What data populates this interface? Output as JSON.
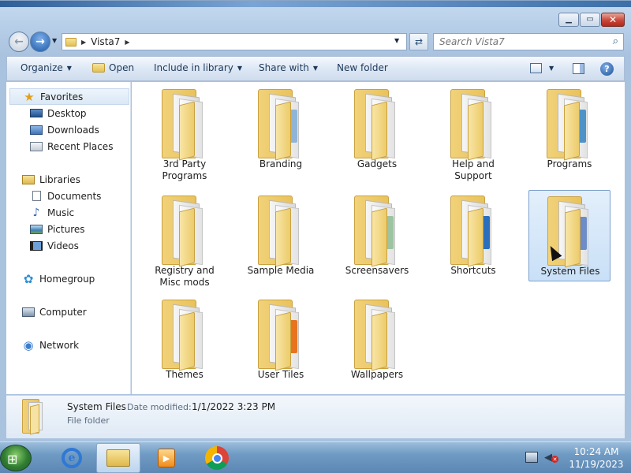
{
  "window": {
    "caption_buttons": {
      "minimize_icon": "minimize-icon",
      "maximize_icon": "maximize-icon",
      "close_icon": "close-icon"
    }
  },
  "address_bar": {
    "breadcrumbs": [
      "Vista7"
    ],
    "search_placeholder": "Search Vista7"
  },
  "command_bar": {
    "organize": "Organize",
    "open": "Open",
    "include_in_library": "Include in library",
    "share_with": "Share with",
    "new_folder": "New folder"
  },
  "navigation": {
    "favorites": {
      "label": "Favorites",
      "items": [
        "Desktop",
        "Downloads",
        "Recent Places"
      ]
    },
    "libraries": {
      "label": "Libraries",
      "items": [
        "Documents",
        "Music",
        "Pictures",
        "Videos"
      ]
    },
    "homegroup": "Homegroup",
    "computer": "Computer",
    "network": "Network"
  },
  "folders": [
    {
      "name": "3rd Party Programs",
      "selected": false
    },
    {
      "name": "Branding",
      "selected": false
    },
    {
      "name": "Gadgets",
      "selected": false
    },
    {
      "name": "Help and Support",
      "selected": false
    },
    {
      "name": "Programs",
      "selected": false
    },
    {
      "name": "Registry and Misc mods",
      "selected": false
    },
    {
      "name": "Sample Media",
      "selected": false
    },
    {
      "name": "Screensavers",
      "selected": false
    },
    {
      "name": "Shortcuts",
      "selected": false
    },
    {
      "name": "System Files",
      "selected": true
    },
    {
      "name": "Themes",
      "selected": false
    },
    {
      "name": "User Tiles",
      "selected": false
    },
    {
      "name": "Wallpapers",
      "selected": false
    }
  ],
  "details": {
    "name": "System Files",
    "date_modified_label": "Date modified:",
    "date_modified_value": "1/1/2022 3:23 PM",
    "type": "File folder"
  },
  "taskbar": {
    "pinned_icons": [
      "internet-explorer-icon",
      "windows-explorer-icon",
      "media-player-icon",
      "chrome-icon"
    ],
    "active": "windows-explorer-icon",
    "clock_time": "10:24 AM",
    "clock_date": "11/19/2023"
  },
  "colors": {
    "selection": "#c9e0f7",
    "folder": "#e9c25c",
    "taskbar": "#6e9ac3"
  }
}
